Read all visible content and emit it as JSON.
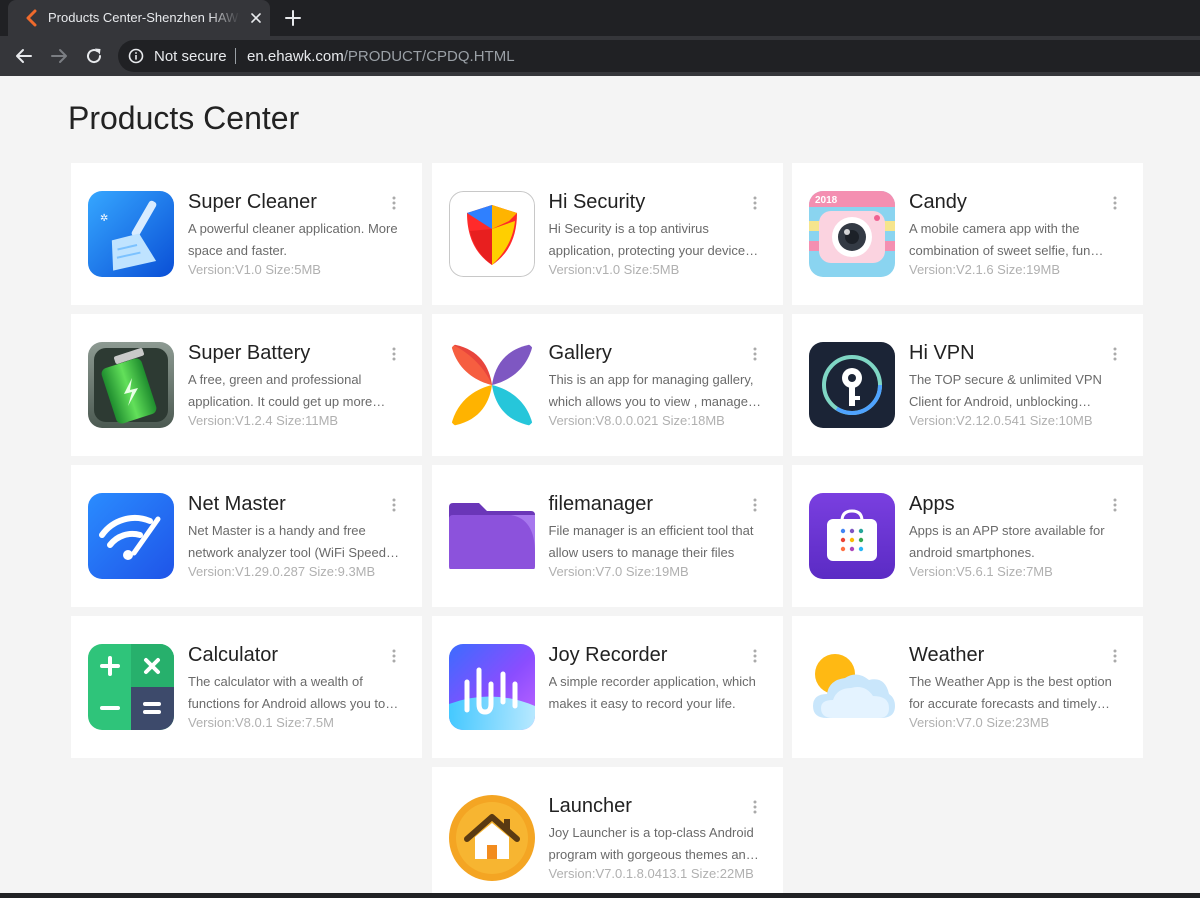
{
  "browser": {
    "tab_title": "Products Center-Shenzhen HAWK Internet",
    "not_secure_label": "Not secure",
    "url_host": "en.ehawk.com",
    "url_path": "/PRODUCT/CPDQ.HTML"
  },
  "page": {
    "title": "Products Center"
  },
  "products": [
    {
      "name": "Super Cleaner",
      "desc": "A powerful cleaner application. More space and faster.",
      "meta": "Version:V1.0 Size:5MB",
      "icon": "broom-icon"
    },
    {
      "name": "Hi Security",
      "desc": "Hi Security is a top antivirus application, protecting your device from viruses.",
      "meta": "Version:v1.0 Size:5MB",
      "icon": "shield-icon"
    },
    {
      "name": "Candy",
      "desc": "A mobile camera app with the combination of sweet selfie, fun stickers and filters.",
      "meta": "Version:V2.1.6 Size:19MB",
      "icon": "camera-icon"
    },
    {
      "name": "Super Battery",
      "desc": "A free, green and professional application. It could get up more battery life.",
      "meta": "Version:V1.2.4 Size:11MB",
      "icon": "battery-icon"
    },
    {
      "name": "Gallery",
      "desc": "This is an app for managing gallery, which allows you to view , manage and share photos.",
      "meta": "Version:V8.0.0.021 Size:18MB",
      "icon": "gallery-petals-icon"
    },
    {
      "name": "Hi VPN",
      "desc": "The TOP secure & unlimited VPN Client for Android, unblocking websites.",
      "meta": "Version:V2.12.0.541 Size:10MB",
      "icon": "vpn-key-icon"
    },
    {
      "name": "Net Master",
      "desc": "Net Master is a handy and free network analyzer tool (WiFi Speed test).",
      "meta": "Version:V1.29.0.287 Size:9.3MB",
      "icon": "wifi-icon"
    },
    {
      "name": "filemanager",
      "desc": "File manager is an efficient tool that allow users to manage their files",
      "meta": "Version:V7.0 Size:19MB",
      "icon": "folder-icon"
    },
    {
      "name": "Apps",
      "desc": "Apps is an APP store available for android smartphones.",
      "meta": "Version:V5.6.1 Size:7MB",
      "icon": "store-bag-icon"
    },
    {
      "name": "Calculator",
      "desc": "The calculator with a wealth of functions for Android allows you to calculate easily.",
      "meta": "Version:V8.0.1 Size:7.5M",
      "icon": "calculator-icon"
    },
    {
      "name": "Joy Recorder",
      "desc": "A simple recorder application, which makes it easy to record your life.",
      "meta": "",
      "icon": "waveform-icon"
    },
    {
      "name": "Weather",
      "desc": "The Weather App is the best option for accurate forecasts and timely weather alerts.",
      "meta": "Version:V7.0 Size:23MB",
      "icon": "weather-sun-cloud-icon"
    },
    {
      "name": "Launcher",
      "desc": "Joy Launcher is a top-class Android program with gorgeous themes and wallpapers.",
      "meta": "Version:V7.0.1.8.0413.1 Size:22MB",
      "icon": "home-icon"
    }
  ]
}
